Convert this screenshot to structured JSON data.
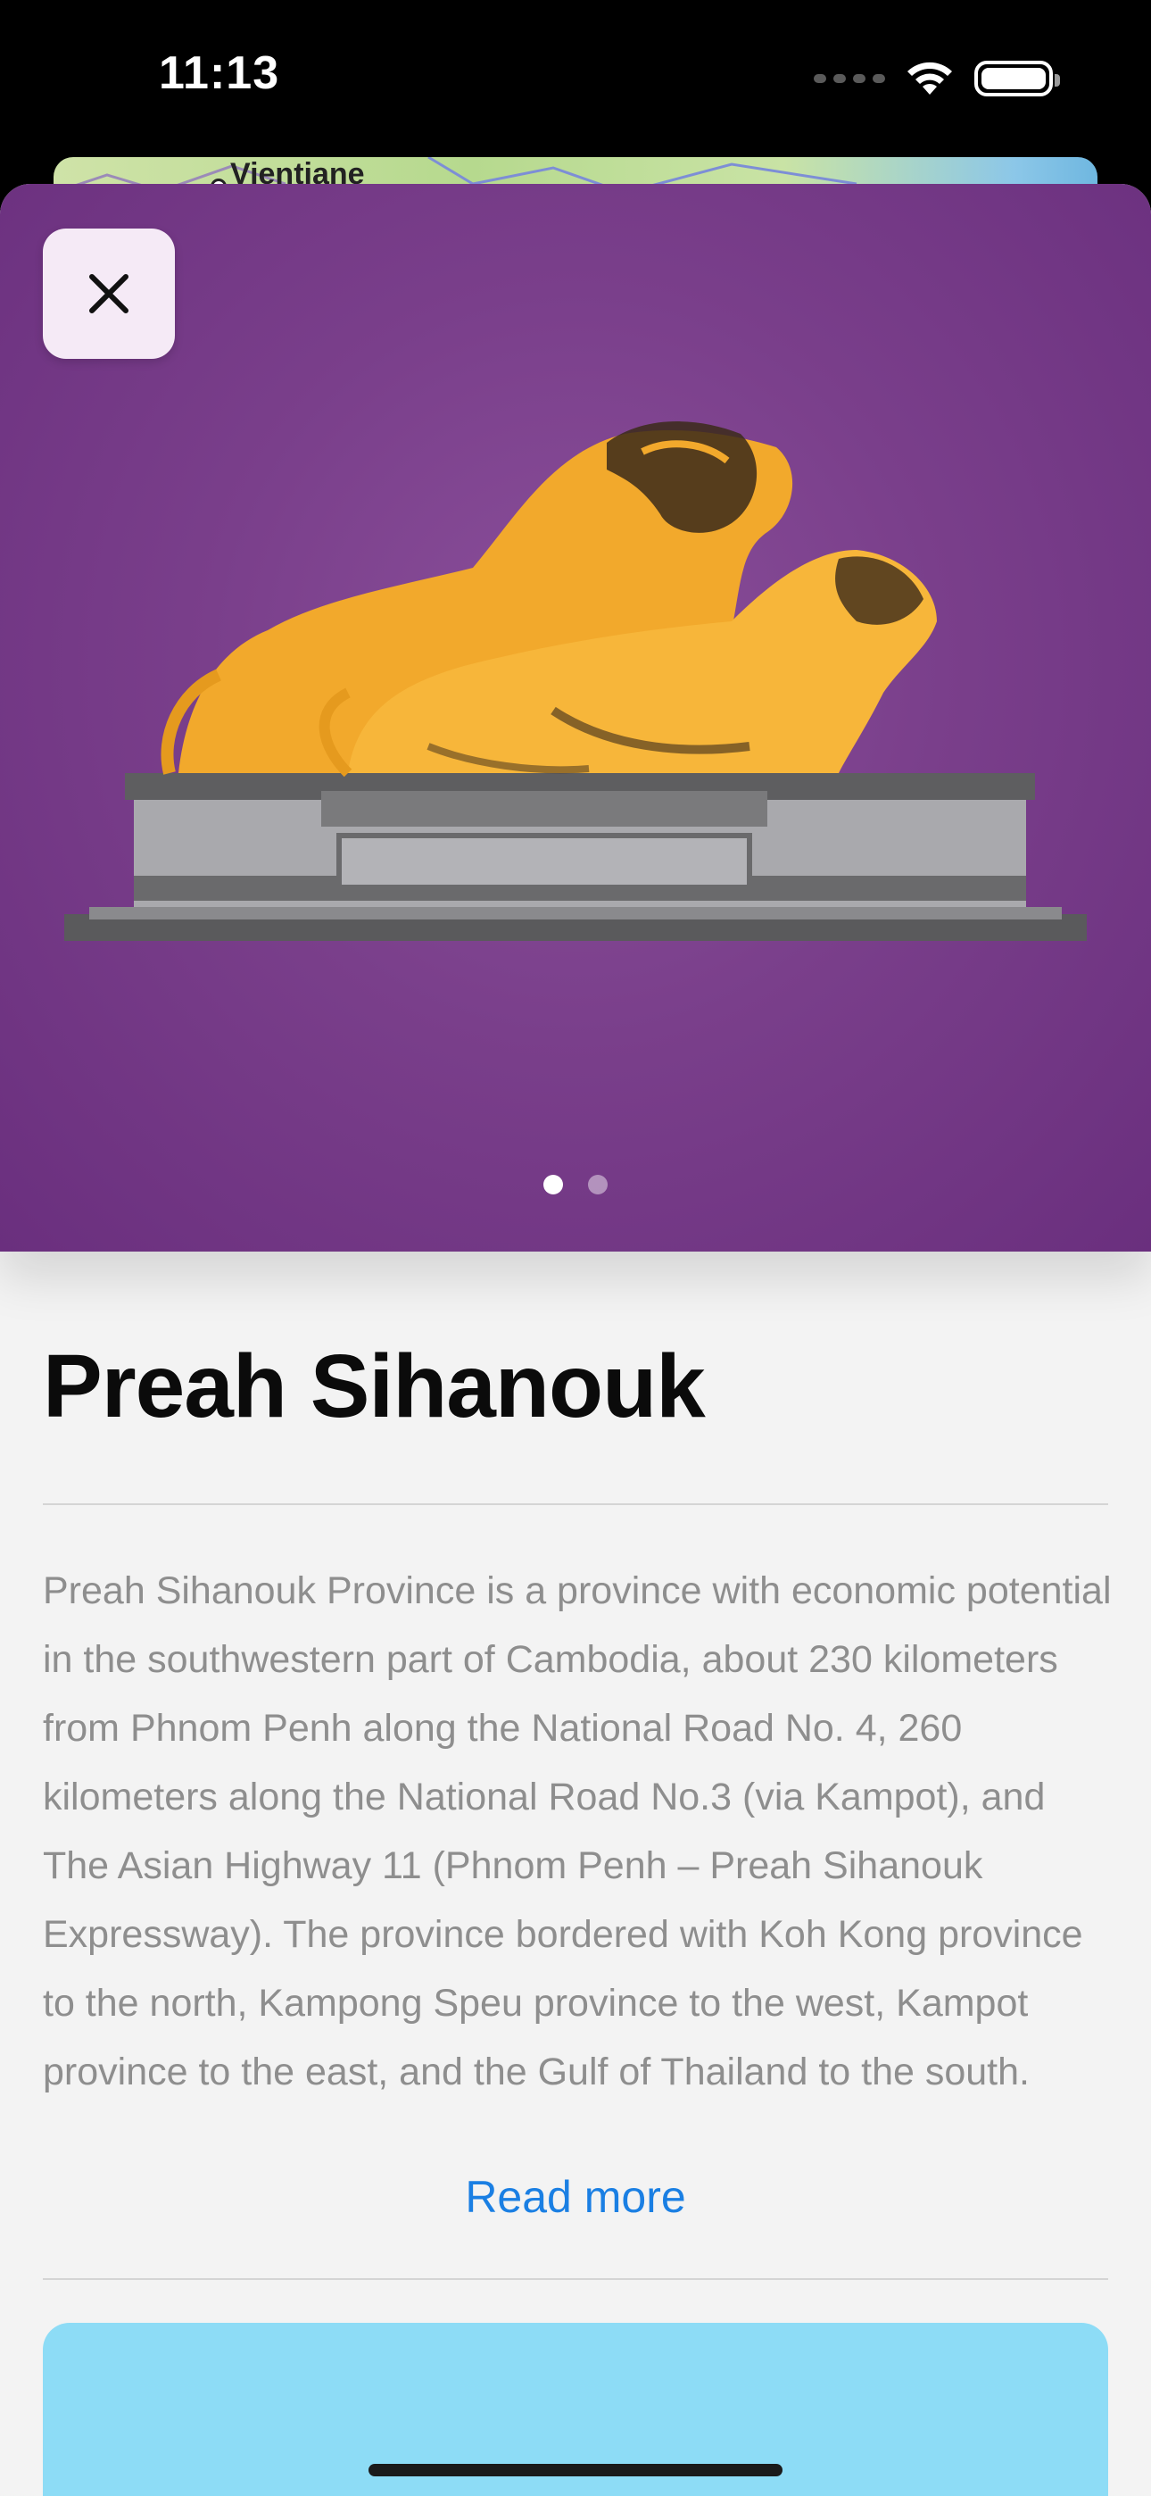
{
  "status_bar": {
    "time": "11:13"
  },
  "map": {
    "city_label": "Vientiane"
  },
  "hero": {
    "page_count": 2,
    "active_page": 1
  },
  "place": {
    "title": "Preah Sihanouk",
    "description": "Preah Sihanouk Province is a province with economic potential in the southwestern part of Cambodia, about 230 kilometers from Phnom Penh along the National Road No. 4, 260 kilometers along the National Road No.3 (via Kampot), and The Asian Highway 11 (Phnom Penh – Preah Sihanouk Expressway). The province bordered with Koh Kong province to the north, Kampong Speu province to the west, Kampot province to the east, and the Gulf of Thailand to the south.",
    "read_more_label": "Read more"
  },
  "colors": {
    "hero_purple": "#7a3f8b",
    "link_blue": "#1a7fe3",
    "card_blue": "#8ddcf6",
    "statue_gold": "#f2a92c"
  },
  "icons": {
    "close": "close-icon",
    "wifi": "wifi-icon",
    "battery": "battery-icon",
    "signal": "cellular-signal-icon"
  }
}
